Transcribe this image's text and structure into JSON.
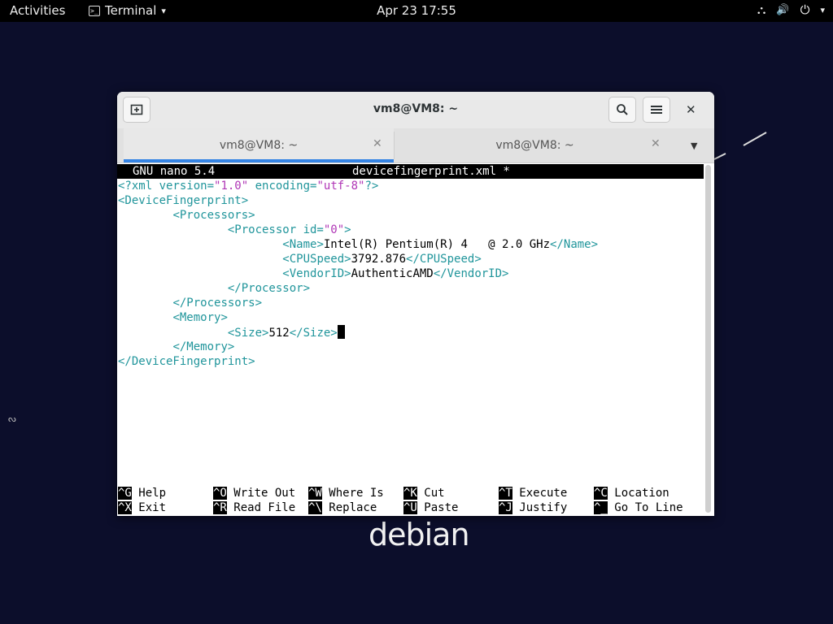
{
  "topbar": {
    "activities": "Activities",
    "app_name": "Terminal",
    "app_caret": "▾",
    "clock": "Apr 23  17:55",
    "status": {
      "network_icon": "⛬",
      "volume_icon": "🔊",
      "power_icon": "⏻",
      "caret": "▾"
    }
  },
  "window": {
    "title": "vm8@VM8: ~",
    "new_tab_icon": "⊞",
    "search_icon": "⌕",
    "menu_icon": "☰",
    "close_icon": "✕",
    "tabs": [
      {
        "label": "vm8@VM8: ~",
        "close": "✕",
        "active": true
      },
      {
        "label": "vm8@VM8: ~",
        "close": "✕",
        "active": false
      }
    ],
    "tab_menu_icon": "▼"
  },
  "nano": {
    "header_left": "GNU nano 5.4",
    "header_file": "devicefingerprint.xml *",
    "lines": {
      "l1": {
        "a": "<?xml version=",
        "b": "\"1.0\"",
        "c": " encoding=",
        "d": "\"utf-8\"",
        "e": "?>"
      },
      "l2": {
        "tag": "<DeviceFingerprint>"
      },
      "l3": {
        "indent": "        ",
        "tag": "<Processors>"
      },
      "l4": {
        "indent": "                ",
        "tag_a": "<Processor id=",
        "str": "\"0\"",
        "tag_b": ">"
      },
      "l5": {
        "indent": "                        ",
        "open": "<Name>",
        "text": "Intel(R) Pentium(R) 4   @ 2.0 GHz",
        "close": "</Name>"
      },
      "l6": {
        "indent": "                        ",
        "open": "<CPUSpeed>",
        "text": "3792.876",
        "close": "</CPUSpeed>"
      },
      "l7": {
        "indent": "                        ",
        "open": "<VendorID>",
        "text": "AuthenticAMD",
        "close": "</VendorID>"
      },
      "l8": {
        "indent": "                ",
        "tag": "</Processor>"
      },
      "l9": {
        "indent": "        ",
        "tag": "</Processors>"
      },
      "l10": {
        "indent": "        ",
        "tag": "<Memory>"
      },
      "l11": {
        "indent": "                ",
        "open": "<Size>",
        "text": "512",
        "close": "</Size>"
      },
      "l12": {
        "indent": "        ",
        "tag": "</Memory>"
      },
      "l13": {
        "tag": "</DeviceFingerprint>"
      }
    },
    "shortcuts": [
      {
        "key": "^G",
        "label": " Help"
      },
      {
        "key": "^O",
        "label": " Write Out"
      },
      {
        "key": "^W",
        "label": " Where Is"
      },
      {
        "key": "^K",
        "label": " Cut"
      },
      {
        "key": "^T",
        "label": " Execute"
      },
      {
        "key": "^C",
        "label": " Location"
      },
      {
        "key": "^X",
        "label": " Exit"
      },
      {
        "key": "^R",
        "label": " Read File"
      },
      {
        "key": "^\\",
        "label": " Replace"
      },
      {
        "key": "^U",
        "label": " Paste"
      },
      {
        "key": "^J",
        "label": " Justify"
      },
      {
        "key": "^_",
        "label": " Go To Line"
      }
    ]
  },
  "desktop": {
    "logo": "debian",
    "left_mark": "ᔓ"
  }
}
